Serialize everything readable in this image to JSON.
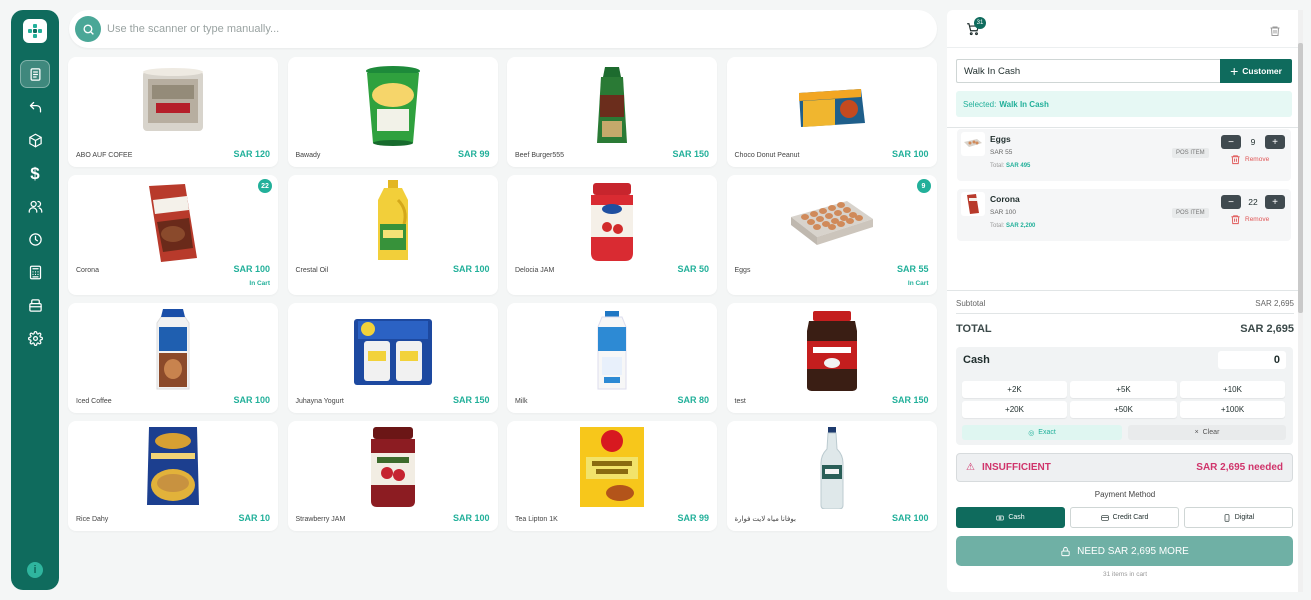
{
  "search": {
    "placeholder": "Use the scanner or type manually..."
  },
  "products": [
    {
      "name": "ABO AUF COFEE",
      "price": "SAR 120"
    },
    {
      "name": "Bawady",
      "price": "SAR 99"
    },
    {
      "name": "Beef Burger555",
      "price": "SAR 150"
    },
    {
      "name": "Choco Donut Peanut",
      "price": "SAR 100"
    },
    {
      "name": "Corona",
      "price": "SAR 100",
      "badge": "22",
      "in_cart": "In Cart"
    },
    {
      "name": "Crestal Oil",
      "price": "SAR 100"
    },
    {
      "name": "Delocia JAM",
      "price": "SAR 50"
    },
    {
      "name": "Eggs",
      "price": "SAR 55",
      "badge": "9",
      "in_cart": "In Cart"
    },
    {
      "name": "Iced Coffee",
      "price": "SAR 100"
    },
    {
      "name": "Juhayna Yogurt",
      "price": "SAR 150"
    },
    {
      "name": "Milk",
      "price": "SAR 80"
    },
    {
      "name": "test",
      "price": "SAR 150"
    },
    {
      "name": "Rice Dahy",
      "price": "SAR 10"
    },
    {
      "name": "Strawberry JAM",
      "price": "SAR 100"
    },
    {
      "name": "Tea Lipton 1K",
      "price": "SAR 99"
    },
    {
      "name": "بوفانا مياه لايت فوارة",
      "price": "SAR 100"
    }
  ],
  "cart": {
    "count": "31",
    "customer_value": "Walk In Cash",
    "customer_button": "Customer",
    "selected_prefix": "Selected:",
    "selected_name": "Walk In Cash",
    "items": [
      {
        "name": "Eggs",
        "price": "SAR 55",
        "total_label": "Total:",
        "total": "SAR 495",
        "tag": "POS ITEM",
        "qty": "9",
        "remove": "Remove"
      },
      {
        "name": "Corona",
        "price": "SAR 100",
        "total_label": "Total:",
        "total": "SAR 2,200",
        "tag": "POS ITEM",
        "qty": "22",
        "remove": "Remove"
      }
    ],
    "subtotal_label": "Subtotal",
    "subtotal": "SAR 2,695",
    "total_label": "TOTAL",
    "total": "SAR 2,695",
    "cash_label": "Cash",
    "cash_value": "0",
    "quick_amounts": [
      "+2K",
      "+5K",
      "+10K",
      "+20K",
      "+50K",
      "+100K"
    ],
    "exact_label": "Exact",
    "clear_label": "Clear",
    "insufficient_label": "INSUFFICIENT",
    "needed": "SAR 2,695 needed",
    "payment_method_title": "Payment Method",
    "payment_methods": [
      "Cash",
      "Credit Card",
      "Digital"
    ],
    "need_button": "NEED SAR 2,695 MORE",
    "items_in_cart": "31 items in cart"
  },
  "colors": {
    "brand": "#0f6b5d",
    "accent": "#22b09a",
    "danger": "#d0346b"
  }
}
